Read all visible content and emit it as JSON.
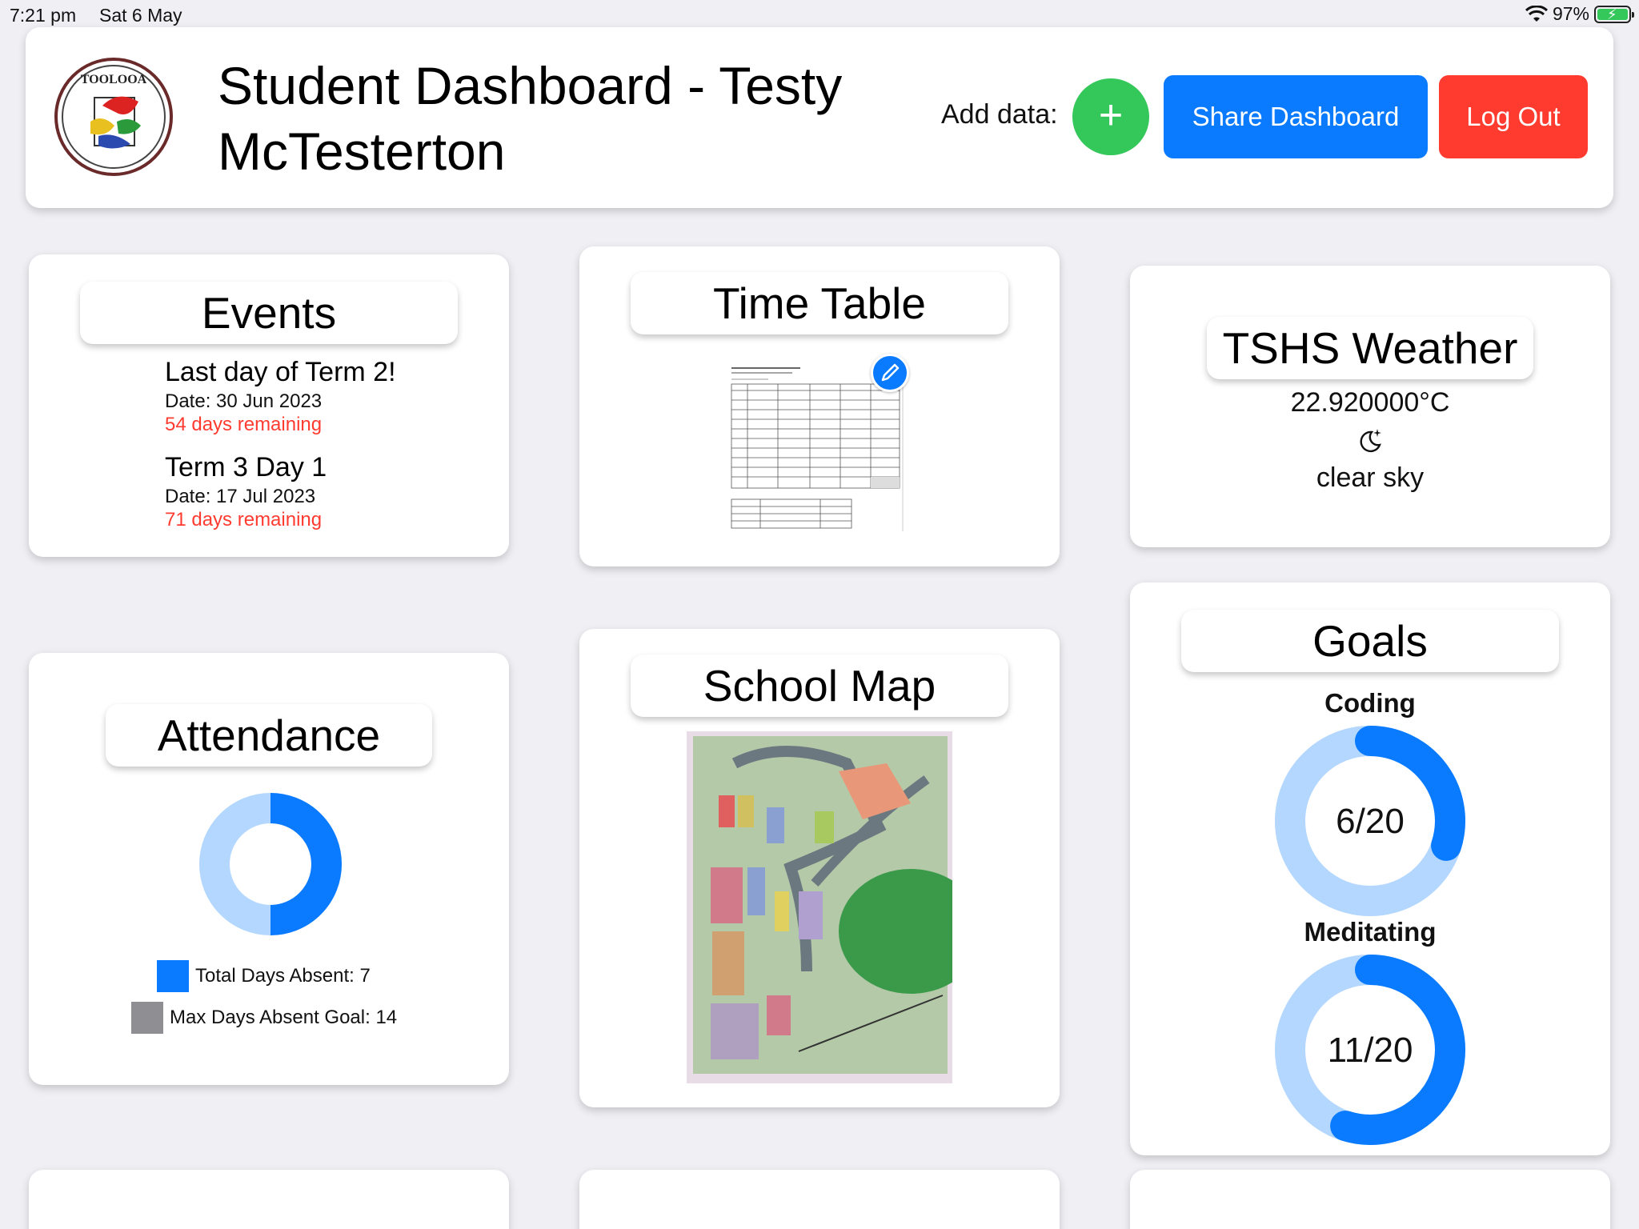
{
  "status": {
    "time": "7:21 pm",
    "date": "Sat 6 May",
    "battery": "97%"
  },
  "header": {
    "logo_text": "TOOLOOA",
    "title": "Student Dashboard - Testy McTesterton",
    "add_data_label": "Add data:",
    "add_button_icon": "+",
    "share_label": "Share Dashboard",
    "logout_label": "Log Out"
  },
  "events": {
    "title": "Events",
    "items": [
      {
        "name": "Last day of Term 2!",
        "date": "Date: 30 Jun 2023",
        "remaining": "54 days remaining"
      },
      {
        "name": "Term 3 Day 1",
        "date": "Date: 17 Jul 2023",
        "remaining": "71 days remaining"
      }
    ]
  },
  "timetable": {
    "title": "Time Table"
  },
  "weather": {
    "title": "TSHS Weather",
    "temperature": "22.920000°C",
    "icon": "moon-stars-icon",
    "description": "clear sky"
  },
  "attendance": {
    "title": "Attendance",
    "absent": 7,
    "goal": 14,
    "legend_absent": "Total Days Absent: 7",
    "legend_goal": "Max Days Absent Goal: 14"
  },
  "map": {
    "title": "School Map"
  },
  "goals": {
    "title": "Goals",
    "items": [
      {
        "name": "Coding",
        "value": "6/20",
        "progress": 0.3
      },
      {
        "name": "Meditating",
        "value": "11/20",
        "progress": 0.55
      }
    ]
  },
  "colors": {
    "accent_blue": "#0a7aff",
    "light_blue": "#b3d7ff",
    "green": "#34c759",
    "red": "#ff3b30",
    "gray": "#8e8e93"
  }
}
